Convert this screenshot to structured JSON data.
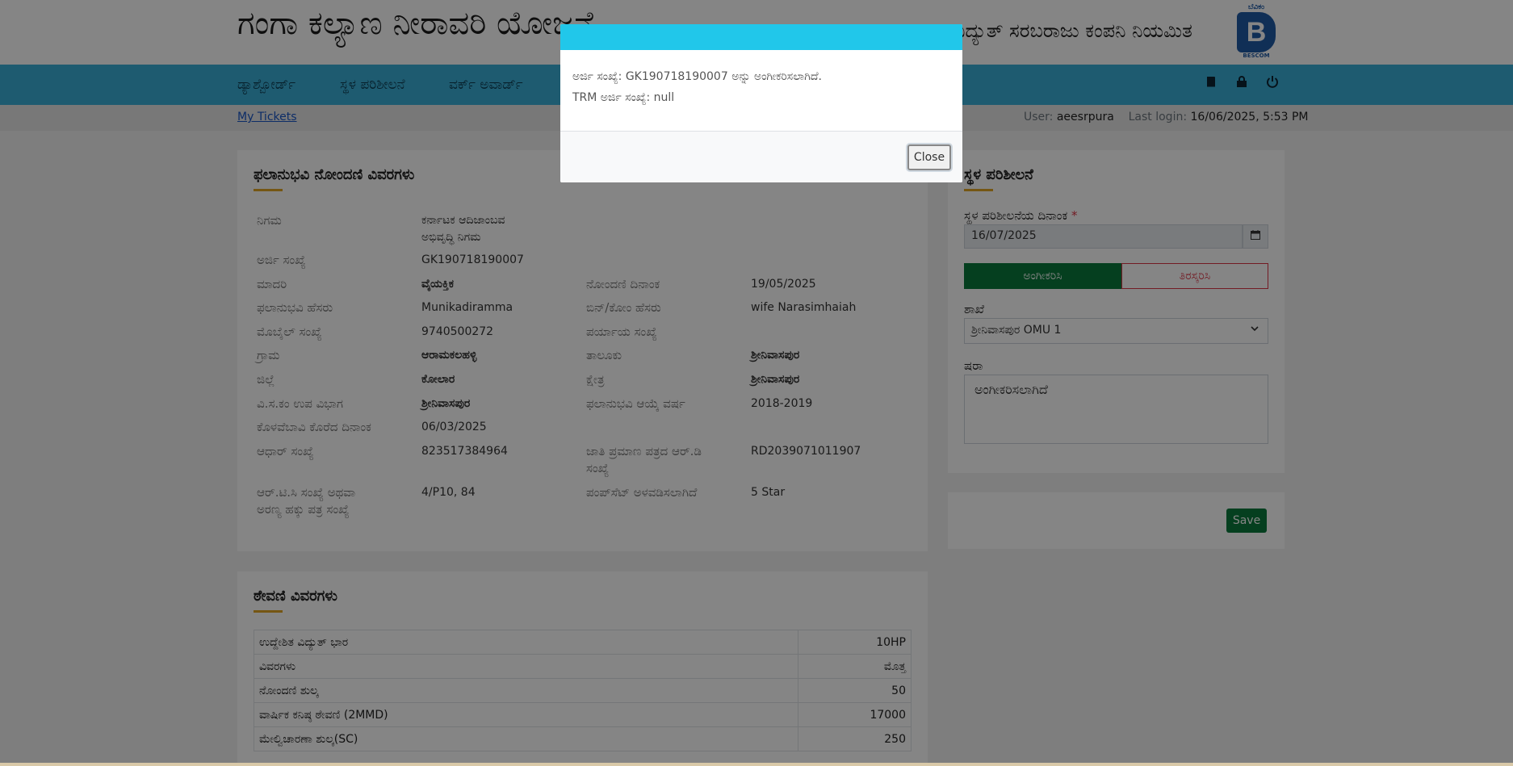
{
  "header": {
    "title": "ಗಂಗಾ ಕಲ್ಯಾಣ ನೀರಾವರಿ ಯೋಜನೆ",
    "company": "ವಿದ್ಯುತ್ ಸರಬರಾಜು ಕಂಪನಿ ನಿಯಮಿತ",
    "logo_text": "B",
    "logo_top": "ಬೆವಿಕಂ",
    "logo_bottom": "BESCOM"
  },
  "nav": {
    "items": [
      "ಡ್ಯಾಶ್ಬೋರ್ಡ್",
      "ಸ್ಥಳ ಪರಿಶೀಲನೆ",
      "ವರ್ಕ್ ಅವಾರ್ಡ್"
    ],
    "icons": [
      "book-icon",
      "lock-icon",
      "power-icon"
    ]
  },
  "subbar": {
    "my_tickets": "My Tickets",
    "user_label": "User:",
    "user": "aeesrpura",
    "last_login_label": "Last login:",
    "last_login": "16/06/2025, 5:53 PM"
  },
  "beneficiary": {
    "title": "ಫಲಾನುಭವಿ ನೋಂದಣಿ ವಿವರಗಳು",
    "rows": [
      {
        "label": "ನಿಗಮ",
        "value": "ಕರ್ನಾಟಕ ಆದಿಜಾಂಬವ",
        "value2": "ಅಭಿವೃದ್ಧಿ ನಿಗಮ"
      },
      {
        "label": "ಅರ್ಜಿ ಸಂಖ್ಯೆ",
        "value": "GK190718190007"
      },
      {
        "label": "ಮಾದರಿ",
        "value": "ವೈಯಕ್ತಿಕ",
        "label2": "ನೋಂದಣಿ ದಿನಾಂಕ",
        "value3": "19/05/2025"
      },
      {
        "label": "ಫಲಾನುಭವಿ ಹೆಸರು",
        "value": "Munikadiramma",
        "label2": "ಬಿನ್/ಕೋಂ ಹೆಸರು",
        "value3": "wife Narasimhaiah"
      },
      {
        "label": "ಮೊಬೈಲ್ ಸಂಖ್ಯೆ",
        "value": "9740500272",
        "label2": "ಪರ್ಯಾಯ ಸಂಖ್ಯೆ",
        "value3": ""
      },
      {
        "label": "ಗ್ರಾಮ",
        "value": "ಆರಾಮಕಲಹಳ್ಳಿ",
        "label2": "ತಾಲೂಕು",
        "value3": "ಶ್ರೀನಿವಾಸಪುರ"
      },
      {
        "label": "ಜಿಲ್ಲೆ",
        "value": "ಕೋಲಾರ",
        "label2": "ಕ್ಷೇತ್ರ",
        "value3": "ಶ್ರೀನಿವಾಸಪುರ"
      },
      {
        "label": "ವಿ.ಸ.ಕಂ ಉಪ ವಿಭಾಗ",
        "value": "ಶ್ರೀನಿವಾಸಪುರ",
        "label2": "ಫಲಾನುಭವಿ ಆಯ್ಕೆ ವರ್ಷ",
        "value3": "2018-2019"
      },
      {
        "label": "ಕೊಳವೆಬಾವಿ ಕೊರೆದ ದಿನಾಂಕ",
        "value": "06/03/2025"
      },
      {
        "label": "ಆಧಾರ್ ಸಂಖ್ಯೆ",
        "value": "823517384964",
        "label2": "ಜಾತಿ ಪ್ರಮಾಣ ಪತ್ರದ ಆರ್.ಡಿ",
        "label2b": "ಸಂಖ್ಯೆ",
        "value3": "RD2039071011907"
      },
      {
        "label": "ಆರ್.ಟಿ.ಸಿ ಸಂಖ್ಯೆ ಅಥವಾ",
        "label_b": "ಅರಣ್ಯ ಹಕ್ಕು ಪತ್ರ ಸಂಖ್ಯೆ",
        "value": "4/P10, 84",
        "label2": "ಪಂಪ್‌ಸೆಟ್ ಅಳವಡಿಸಲಾಗಿದೆ",
        "value3": "5 Star"
      }
    ]
  },
  "demand": {
    "title": "ಠೇವಣಿ ವಿವರಗಳು",
    "rows": [
      {
        "label": "ಉದ್ದೇಶಿತ ವಿದ್ಯುತ್ ಭಾರ",
        "value": "10HP"
      },
      {
        "label": "ವಿವರಗಳು",
        "value": "ಮೊತ್ತ"
      },
      {
        "label": "ನೋಂದಣಿ ಶುಲ್ಕ",
        "value": "50"
      },
      {
        "label": "ವಾರ್ಷಿಕ ಕನಿಷ್ಠ ಠೇವಣಿ (2MMD)",
        "value": "17000"
      },
      {
        "label": "ಮೇಲ್ವಿಚಾರಣಾ ಶುಲ್ಕ(SC)",
        "value": "250"
      }
    ]
  },
  "inspection": {
    "title": "ಸ್ಥಳ ಪರಿಶೀಲನೆ",
    "date_label": "ಸ್ಥಳ ಪರಿಶೀಲನೆಯ ದಿನಾಂಕ",
    "required": "*",
    "date_value": "16/07/2025",
    "accept_label": "ಅಂಗೀಕರಿಸಿ",
    "reject_label": "ತಿರಸ್ಕರಿಸಿ",
    "branch_label": "ಶಾಖೆ",
    "branch_value": "ಶ್ರೀನಿವಾಸಪುರ OMU 1",
    "remarks_label": "ಷರಾ",
    "remarks_value": "ಅಂಗೀಕರಿಸಲಾಗಿದೆ",
    "save_label": "Save"
  },
  "modal": {
    "line1": "ಅರ್ಜಿ ಸಂಖ್ಯೆ: GK190718190007 ಅನ್ನು ಅಂಗೀಕರಿಸಲಾಗಿದೆ.",
    "line2": "TRM ಅರ್ಜಿ ಸಂಖ್ಯೆ: null",
    "close_label": "Close"
  },
  "colors": {
    "nav": "#3aaed6",
    "modal_header": "#21c7ea",
    "accept": "#0a7a3c",
    "reject": "#dc3545",
    "accent": "#e0a526"
  }
}
